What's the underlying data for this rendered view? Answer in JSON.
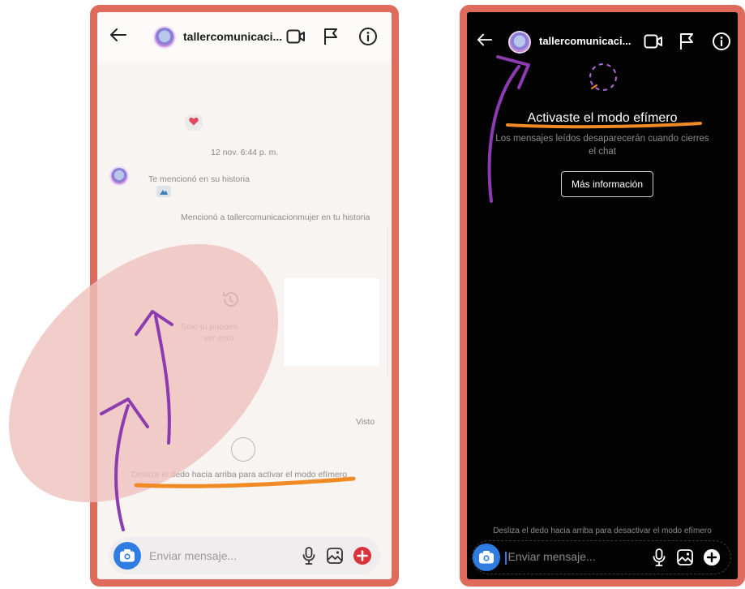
{
  "left": {
    "header": {
      "username": "tallercomunicaci..."
    },
    "date_label": "12 nov. 6:44 p. m.",
    "mention_text": "Te mencionó en su historia",
    "mentioned_text": "Mencionó a tallercomunicacionmujer en tu historia",
    "only_you_line1": "Solo tú puedes",
    "only_you_line2": "ver esto.",
    "seen_label": "Visto",
    "swipe_hint": "Desliza el dedo hacia arriba para activar el modo efímero",
    "compose_placeholder": "Enviar mensaje..."
  },
  "right": {
    "header": {
      "username": "tallercomunicaci..."
    },
    "title": "Activaste el modo efímero",
    "description_line1": "Los mensajes leídos desaparecerán cuando cierres",
    "description_line2": "el chat",
    "more_info_button": "Más información",
    "swipe_hint": "Desliza el dedo hacia arriba para desactivar el modo efímero",
    "compose_placeholder": "Enviar mensaje..."
  },
  "colors": {
    "frame": "#df6b5c",
    "annotation_purple": "#8c3bb0",
    "annotation_orange": "#f08a24",
    "highlight_blob": "#eec1bd",
    "accent_blue": "#2f7de0",
    "add_red": "#d9323a"
  },
  "icons": [
    "back-arrow-icon",
    "video-call-icon",
    "flag-icon",
    "info-icon",
    "heart-icon",
    "history-icon",
    "camera-icon",
    "microphone-icon",
    "gallery-icon",
    "plus-circle-icon"
  ]
}
